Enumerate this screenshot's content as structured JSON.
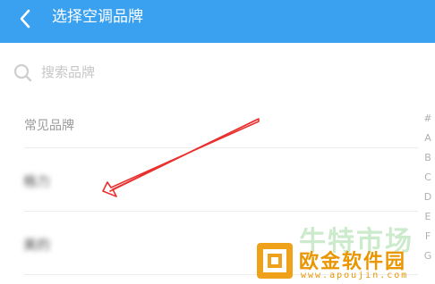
{
  "header": {
    "title": "选择空调品牌",
    "back_icon": "chevron-left-icon",
    "background": "#3aa0f0"
  },
  "search": {
    "placeholder": "搜索品牌",
    "value": "",
    "icon": "search-icon"
  },
  "section": {
    "label": "常见品牌"
  },
  "brands": [
    {
      "name": "格力"
    },
    {
      "name": "美的"
    }
  ],
  "index_bar": [
    "#",
    "A",
    "B",
    "C",
    "D",
    "E",
    "F",
    "G"
  ],
  "annotation": {
    "arrow_color": "#e8312f"
  },
  "watermark": {
    "top_text": "牛特市场",
    "brand": "欧金软件园",
    "url": "www.apoujin.com",
    "brand_color": "#e99600"
  }
}
